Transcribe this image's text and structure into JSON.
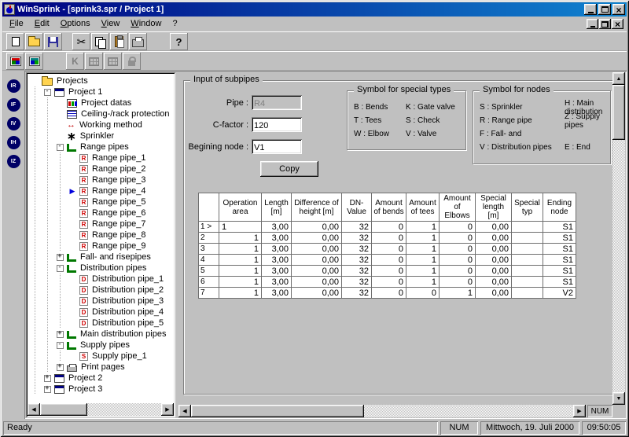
{
  "window": {
    "title": "WinSprink - [sprink3.spr / Project 1]",
    "colors": {
      "titlebar_left": "#000080",
      "titlebar_right": "#1084d0",
      "window_bg": "#c0c0c0",
      "marker": "#0000dd"
    }
  },
  "menu": {
    "items": [
      "File",
      "Edit",
      "Options",
      "View",
      "Window",
      "?"
    ]
  },
  "toolbars": {
    "main": [
      {
        "name": "new",
        "icon": "new-document-icon"
      },
      {
        "name": "open",
        "icon": "open-folder-icon"
      },
      {
        "name": "save",
        "icon": "save-icon"
      },
      {
        "sep": "narrow"
      },
      {
        "name": "cut",
        "icon": "scissors-icon"
      },
      {
        "name": "copy",
        "icon": "copy-icon"
      },
      {
        "name": "paste",
        "icon": "paste-icon"
      },
      {
        "name": "print",
        "icon": "printer-icon"
      },
      {
        "sep": "wide"
      },
      {
        "name": "help",
        "icon": "help-icon"
      }
    ],
    "secondary": [
      {
        "name": "pipe-tables",
        "icon": "table-colored-icon"
      },
      {
        "name": "node-tables",
        "icon": "table-colored2-icon"
      },
      {
        "sep": "wide"
      },
      {
        "name": "k-factor",
        "icon": "k-icon",
        "disabled": true
      },
      {
        "name": "grid-view-1",
        "icon": "grid-gray-icon",
        "disabled": true
      },
      {
        "name": "grid-view-2",
        "icon": "grid-gray2-icon",
        "disabled": true
      },
      {
        "name": "lock",
        "icon": "lock-icon",
        "disabled": true
      }
    ]
  },
  "side_buttons": [
    {
      "name": "range-pipes-shortcut",
      "label": "IR"
    },
    {
      "name": "fall-pipes-shortcut",
      "label": "IF"
    },
    {
      "name": "distribution-pipes-shortcut",
      "label": "IV"
    },
    {
      "name": "main-distribution-shortcut",
      "label": "IH"
    },
    {
      "name": "supply-pipes-shortcut",
      "label": "IZ"
    }
  ],
  "tree": {
    "items": [
      {
        "label": "Projects",
        "level": 0,
        "icon": "projects-folder"
      },
      {
        "label": "Project 1",
        "level": 1,
        "expander": "minus",
        "icon": "project"
      },
      {
        "label": "Project datas",
        "level": 2,
        "icon": "project-datas"
      },
      {
        "label": "Ceiling-/rack protection",
        "level": 2,
        "icon": "ceiling-protection"
      },
      {
        "label": "Working method",
        "level": 2,
        "icon": "working-method"
      },
      {
        "label": "Sprinkler",
        "level": 2,
        "icon": "sprinkler"
      },
      {
        "label": "Range pipes",
        "level": 2,
        "expander": "minus",
        "icon": "pipes-branch"
      },
      {
        "label": "Range pipe_1",
        "level": 3,
        "icon": "pipe-leaf",
        "letter": "R"
      },
      {
        "label": "Range pipe_2",
        "level": 3,
        "icon": "pipe-leaf",
        "letter": "R"
      },
      {
        "label": "Range pipe_3",
        "level": 3,
        "icon": "pipe-leaf",
        "letter": "R"
      },
      {
        "label": "Range pipe_4",
        "level": 3,
        "icon": "pipe-leaf",
        "letter": "R",
        "marker": true
      },
      {
        "label": "Range pipe_5",
        "level": 3,
        "icon": "pipe-leaf",
        "letter": "R"
      },
      {
        "label": "Range pipe_6",
        "level": 3,
        "icon": "pipe-leaf",
        "letter": "R"
      },
      {
        "label": "Range pipe_7",
        "level": 3,
        "icon": "pipe-leaf",
        "letter": "R"
      },
      {
        "label": "Range pipe_8",
        "level": 3,
        "icon": "pipe-leaf",
        "letter": "R"
      },
      {
        "label": "Range pipe_9",
        "level": 3,
        "icon": "pipe-leaf",
        "letter": "R"
      },
      {
        "label": "Fall- and risepipes",
        "level": 2,
        "expander": "plus",
        "icon": "pipes-branch"
      },
      {
        "label": "Distribution pipes",
        "level": 2,
        "expander": "minus",
        "icon": "pipes-branch"
      },
      {
        "label": "Distribution pipe_1",
        "level": 3,
        "icon": "pipe-leaf",
        "letter": "D"
      },
      {
        "label": "Distribution pipe_2",
        "level": 3,
        "icon": "pipe-leaf",
        "letter": "D"
      },
      {
        "label": "Distribution pipe_3",
        "level": 3,
        "icon": "pipe-leaf",
        "letter": "D"
      },
      {
        "label": "Distribution pipe_4",
        "level": 3,
        "icon": "pipe-leaf",
        "letter": "D"
      },
      {
        "label": "Distribution pipe_5",
        "level": 3,
        "icon": "pipe-leaf",
        "letter": "D"
      },
      {
        "label": "Main distribution pipes",
        "level": 2,
        "expander": "plus",
        "icon": "pipes-branch"
      },
      {
        "label": "Supply pipes",
        "level": 2,
        "expander": "minus",
        "icon": "pipes-branch"
      },
      {
        "label": "Supply pipe_1",
        "level": 3,
        "icon": "pipe-leaf",
        "letter": "S"
      },
      {
        "label": "Print pages",
        "level": 2,
        "expander": "plus",
        "icon": "print-pages"
      },
      {
        "label": "Project 2",
        "level": 1,
        "expander": "plus",
        "icon": "project"
      },
      {
        "label": "Project 3",
        "level": 1,
        "expander": "plus",
        "icon": "project"
      }
    ]
  },
  "panel": {
    "group_title": "Input of subpipes",
    "pipe_label": "Pipe :",
    "pipe_value": "R4",
    "cfactor_label": "C-factor :",
    "cfactor_value": "120",
    "node_label": "Begining node :",
    "node_value": "V1",
    "copy_label": "Copy",
    "special_types": {
      "title": "Symbol for special types",
      "col1": [
        "B : Bends",
        "T : Tees",
        "W : Elbow"
      ],
      "col2": [
        "K : Gate valve",
        "S : Check",
        "V : Valve"
      ]
    },
    "nodes_symbols": {
      "title": "Symbol for nodes",
      "col1": [
        "S : Sprinkler",
        "R : Range pipe",
        "F : Fall- and",
        "V : Distribution pipes"
      ],
      "col2": [
        "H : Main distribution",
        "Z : Supply pipes",
        "",
        "E : End"
      ]
    }
  },
  "grid": {
    "columns": [
      "",
      "Operation area",
      "Length [m]",
      "Difference of height [m]",
      "DN-Value",
      "Amount of bends",
      "Amount of tees",
      "Amount of Elbows",
      "Special length [m]",
      "Special typ",
      "Ending node"
    ],
    "rows": [
      {
        "header": "1 >",
        "current": true,
        "cells": [
          "1",
          "3,00",
          "0,00",
          "32",
          "0",
          "1",
          "0",
          "0,00",
          "",
          "S1"
        ]
      },
      {
        "header": "2",
        "cells": [
          "1",
          "3,00",
          "0,00",
          "32",
          "0",
          "1",
          "0",
          "0,00",
          "",
          "S1"
        ]
      },
      {
        "header": "3",
        "cells": [
          "1",
          "3,00",
          "0,00",
          "32",
          "0",
          "1",
          "0",
          "0,00",
          "",
          "S1"
        ]
      },
      {
        "header": "4",
        "cells": [
          "1",
          "3,00",
          "0,00",
          "32",
          "0",
          "1",
          "0",
          "0,00",
          "",
          "S1"
        ]
      },
      {
        "header": "5",
        "cells": [
          "1",
          "3,00",
          "0,00",
          "32",
          "0",
          "1",
          "0",
          "0,00",
          "",
          "S1"
        ]
      },
      {
        "header": "6",
        "cells": [
          "1",
          "3,00",
          "0,00",
          "32",
          "0",
          "1",
          "0",
          "0,00",
          "",
          "S1"
        ]
      },
      {
        "header": "7",
        "cells": [
          "1",
          "3,00",
          "0,00",
          "32",
          "0",
          "0",
          "1",
          "0,00",
          "",
          "V2"
        ]
      }
    ]
  },
  "statusbar": {
    "ready": "Ready",
    "num": "NUM",
    "child_num": "NUM",
    "date": "Mittwoch, 19. Juli 2000",
    "time": "09:50:05"
  }
}
